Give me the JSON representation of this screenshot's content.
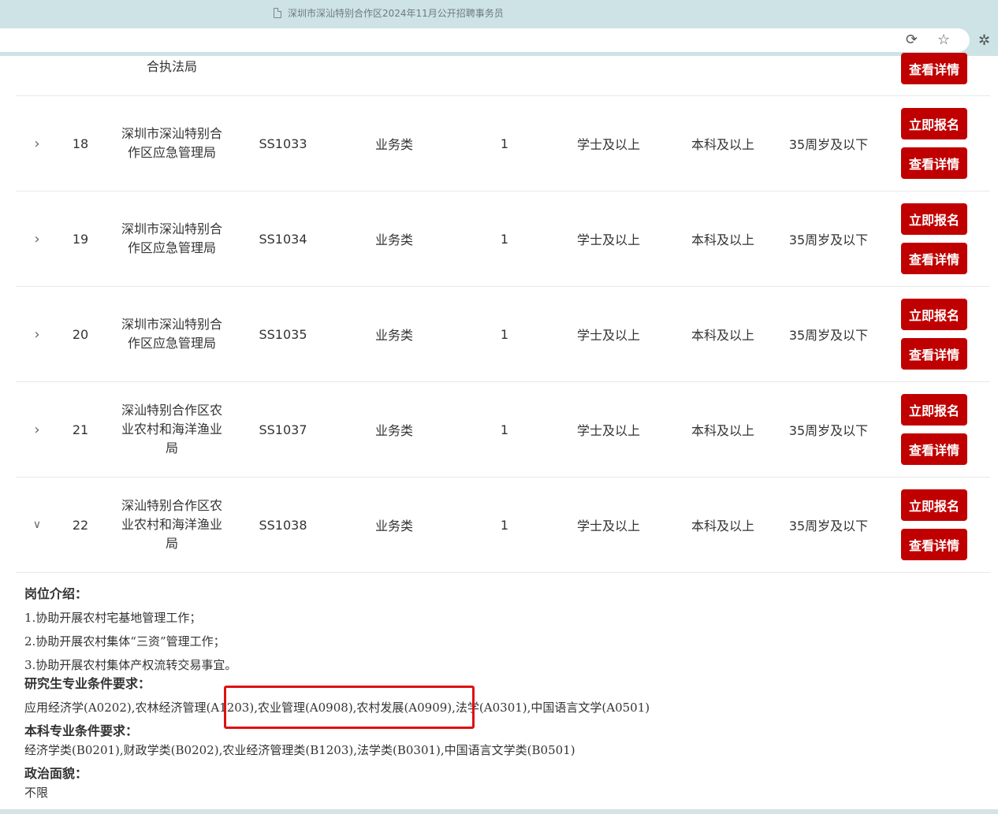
{
  "browser": {
    "tab_title": "深圳市深汕特别合作区2024年11月公开招聘事务员",
    "icons": [
      "refresh-icon",
      "star-icon",
      "extensions-icon"
    ]
  },
  "colors": {
    "primary_button": "#c00000",
    "highlight_box": "#e01010",
    "chrome": "#cde3e6"
  },
  "table": {
    "partial_row": {
      "unit": "合执法局",
      "view_label": "查看详情"
    },
    "rows": [
      {
        "no": "18",
        "unit": "深圳市深汕特别合作区应急管理局",
        "code": "SS1033",
        "type": "业务类",
        "count": "1",
        "degree": "学士及以上",
        "education": "本科及以上",
        "age": "35周岁及以下",
        "apply_label": "立即报名",
        "view_label": "查看详情",
        "expanded": false
      },
      {
        "no": "19",
        "unit": "深圳市深汕特别合作区应急管理局",
        "code": "SS1034",
        "type": "业务类",
        "count": "1",
        "degree": "学士及以上",
        "education": "本科及以上",
        "age": "35周岁及以下",
        "apply_label": "立即报名",
        "view_label": "查看详情",
        "expanded": false
      },
      {
        "no": "20",
        "unit": "深圳市深汕特别合作区应急管理局",
        "code": "SS1035",
        "type": "业务类",
        "count": "1",
        "degree": "学士及以上",
        "education": "本科及以上",
        "age": "35周岁及以下",
        "apply_label": "立即报名",
        "view_label": "查看详情",
        "expanded": false
      },
      {
        "no": "21",
        "unit": "深汕特别合作区农业农村和海洋渔业局",
        "code": "SS1037",
        "type": "业务类",
        "count": "1",
        "degree": "学士及以上",
        "education": "本科及以上",
        "age": "35周岁及以下",
        "apply_label": "立即报名",
        "view_label": "查看详情",
        "expanded": false
      },
      {
        "no": "22",
        "unit": "深汕特别合作区农业农村和海洋渔业局",
        "code": "SS1038",
        "type": "业务类",
        "count": "1",
        "degree": "学士及以上",
        "education": "本科及以上",
        "age": "35周岁及以下",
        "apply_label": "立即报名",
        "view_label": "查看详情",
        "expanded": true
      }
    ]
  },
  "detail": {
    "intro_heading": "岗位介绍：",
    "intro_lines": [
      "1.协助开展农村宅基地管理工作；",
      "2.协助开展农村集体“三资”管理工作；",
      "3.协助开展农村集体产权流转交易事宜。"
    ],
    "grad_heading": "研究生专业条件要求：",
    "grad_text": "应用经济学(A0202),农林经济管理(A1203),农业管理(A0908),农村发展(A0909),法学(A0301),中国语言文学(A0501)",
    "undergrad_heading": "本科专业条件要求：",
    "undergrad_text": "经济学类(B0201),财政学类(B0202),农业经济管理类(B1203),法学类(B0301),中国语言文学类(B0501)",
    "political_heading": "政治面貌：",
    "political_text": "不限"
  }
}
